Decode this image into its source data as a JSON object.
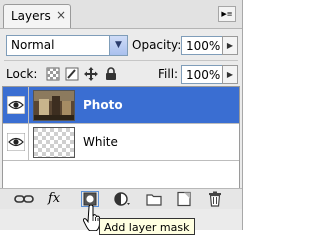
{
  "panel": {
    "tab_title": "Layers",
    "close_glyph": "×",
    "menu_glyph": "▶≡"
  },
  "options": {
    "blend_mode": "Normal",
    "opacity_label": "Opacity:",
    "opacity_value": "100%",
    "lock_label": "Lock:",
    "fill_label": "Fill:",
    "fill_value": "100%",
    "lock_icons": [
      "lock-transparent-pixels-icon",
      "lock-image-pixels-icon",
      "lock-position-icon",
      "lock-all-icon"
    ]
  },
  "layers": [
    {
      "name": "Photo",
      "selected": true,
      "visible": true
    },
    {
      "name": "White",
      "selected": false,
      "visible": true
    }
  ],
  "bottom_bar": {
    "buttons": [
      "link-layers-icon",
      "fx-icon",
      "add-layer-mask-icon",
      "adjustment-layer-icon",
      "new-group-icon",
      "new-layer-icon",
      "delete-layer-icon"
    ],
    "fx_label": "fx"
  },
  "tooltip": {
    "text": "Add layer mask"
  },
  "colors": {
    "selection": "#3a6ed2",
    "panel_bg": "#ebebeb",
    "tooltip_bg": "#ffffe1"
  }
}
